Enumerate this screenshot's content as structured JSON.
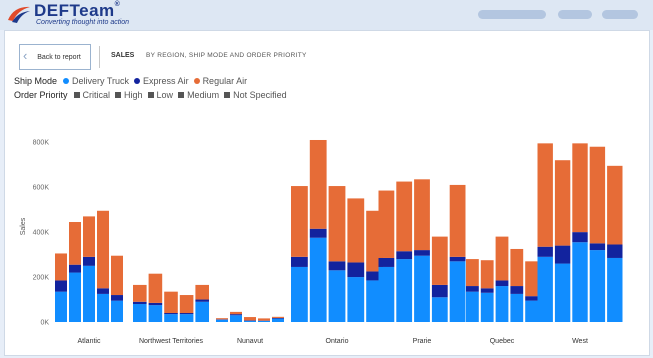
{
  "brand": {
    "name": "DEFTeam",
    "registered": "®",
    "tagline": "Converting thought into action"
  },
  "header": {
    "back_label": "Back to report",
    "section": "SALES",
    "subtitle": "BY REGION, SHIP MODE AND ORDER PRIORITY"
  },
  "legends": {
    "ship_mode": {
      "title": "Ship Mode",
      "items": [
        {
          "label": "Delivery Truck",
          "color": "#118dff"
        },
        {
          "label": "Express Air",
          "color": "#12239e"
        },
        {
          "label": "Regular Air",
          "color": "#e66c37"
        }
      ]
    },
    "order_priority": {
      "title": "Order Priority",
      "items": [
        {
          "label": "Critical"
        },
        {
          "label": "High"
        },
        {
          "label": "Low"
        },
        {
          "label": "Medium"
        },
        {
          "label": "Not Specified"
        }
      ]
    }
  },
  "chart_data": {
    "type": "bar",
    "stacked": true,
    "ylabel": "Sales",
    "ylim": [
      0,
      850000
    ],
    "yticks": [
      {
        "value": 0,
        "label": "0K"
      },
      {
        "value": 200000,
        "label": "200K"
      },
      {
        "value": 400000,
        "label": "400K"
      },
      {
        "value": 600000,
        "label": "600K"
      },
      {
        "value": 800000,
        "label": "800K"
      }
    ],
    "grid": false,
    "categories": [
      "Atlantic",
      "Northwest Territories",
      "Nunavut",
      "Ontario",
      "Prarie",
      "Quebec",
      "West"
    ],
    "subgroups": [
      "Critical",
      "High",
      "Low",
      "Medium",
      "Not Specified"
    ],
    "series_order": [
      "Delivery Truck",
      "Express Air",
      "Regular Air"
    ],
    "colors": {
      "Delivery Truck": "#118dff",
      "Express Air": "#12239e",
      "Regular Air": "#e66c37"
    },
    "data": [
      [
        [
          135000,
          50000,
          120000
        ],
        [
          220000,
          35000,
          190000
        ],
        [
          250000,
          40000,
          180000
        ],
        [
          125000,
          25000,
          345000
        ],
        [
          95000,
          25000,
          175000
        ]
      ],
      [
        [
          80000,
          10000,
          75000
        ],
        [
          75000,
          10000,
          130000
        ],
        [
          35000,
          5000,
          95000
        ],
        [
          35000,
          5000,
          80000
        ],
        [
          90000,
          10000,
          65000
        ]
      ],
      [
        [
          10000,
          2000,
          5000
        ],
        [
          30000,
          5000,
          10000
        ],
        [
          5000,
          2000,
          15000
        ],
        [
          5000,
          1000,
          10000
        ],
        [
          15000,
          3000,
          5000
        ]
      ],
      [
        [
          245000,
          45000,
          315000
        ],
        [
          375000,
          40000,
          395000
        ],
        [
          230000,
          40000,
          335000
        ],
        [
          200000,
          65000,
          285000
        ],
        [
          185000,
          40000,
          270000
        ]
      ],
      [
        [
          245000,
          40000,
          300000
        ],
        [
          280000,
          35000,
          310000
        ],
        [
          295000,
          25000,
          315000
        ],
        [
          110000,
          55000,
          215000
        ],
        [
          270000,
          20000,
          320000
        ]
      ],
      [
        [
          135000,
          25000,
          120000
        ],
        [
          130000,
          20000,
          125000
        ],
        [
          160000,
          25000,
          195000
        ],
        [
          125000,
          35000,
          165000
        ],
        [
          95000,
          20000,
          155000
        ]
      ],
      [
        [
          290000,
          45000,
          460000
        ],
        [
          260000,
          80000,
          380000
        ],
        [
          355000,
          45000,
          395000
        ],
        [
          320000,
          30000,
          430000
        ],
        [
          285000,
          60000,
          350000
        ]
      ]
    ]
  }
}
